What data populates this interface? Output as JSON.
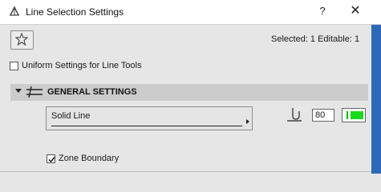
{
  "window": {
    "title": "Line Selection Settings",
    "help_label": "?",
    "close_label": "✕"
  },
  "toolbar": {
    "favorites_icon": "star-icon",
    "selected_info": "Selected: 1 Editable: 1"
  },
  "uniform_settings": {
    "label": "Uniform Settings for Line Tools",
    "checked": false
  },
  "general_settings": {
    "title": "GENERAL SETTINGS",
    "line_type": "Solid Line",
    "pen_number": "80",
    "pen_color": "#19d919"
  },
  "zone_boundary": {
    "label": "Zone Boundary",
    "checked": true
  },
  "colors": {
    "accent_strip": "#2b6ab8",
    "section_header": "#cccccc"
  }
}
